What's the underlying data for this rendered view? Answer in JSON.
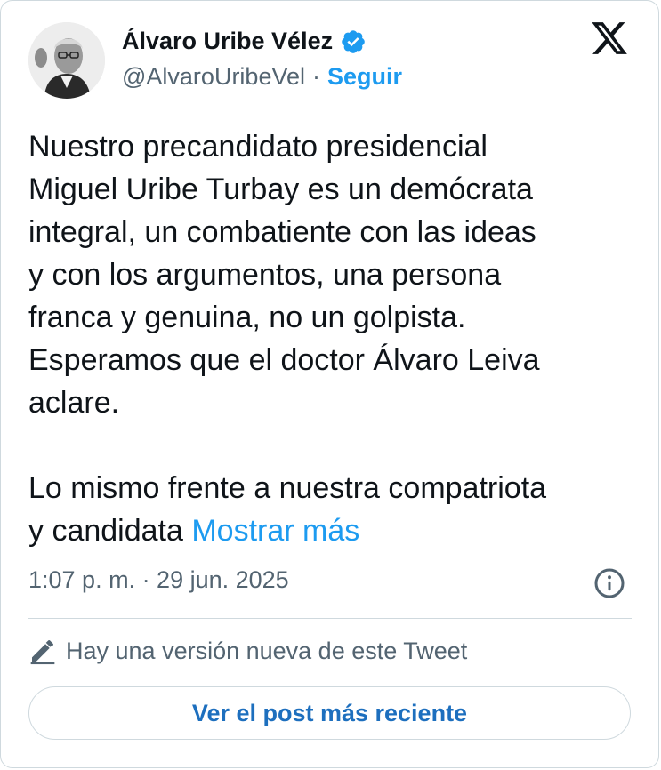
{
  "author": {
    "name": "Álvaro Uribe Vélez",
    "handle": "@AlvaroUribeVel",
    "separator": "·",
    "follow_label": "Seguir",
    "verified_icon": "verified-badge-icon",
    "avatar_alt": "avatar"
  },
  "platform": {
    "logo_icon": "x-logo-icon"
  },
  "tweet": {
    "body": "Nuestro precandidato presidencial\nMiguel Uribe Turbay es un demócrata\nintegral, un combatiente con las ideas\ny con los argumentos, una persona\nfranca y genuina, no un golpista.\nEsperamos que el doctor Álvaro Leiva\naclare.\n\nLo mismo frente a nuestra compatriota\ny candidata ",
    "show_more_label": "Mostrar más",
    "timestamp": "1:07 p. m. · 29 jun. 2025"
  },
  "edit_notice": {
    "text": "Hay una versión nueva de este Tweet",
    "icon": "pencil-icon"
  },
  "cta": {
    "label": "Ver el post más reciente"
  },
  "colors": {
    "accent": "#1d9bf0",
    "link_dark": "#1d6fbe",
    "text_primary": "#0f1419",
    "text_secondary": "#536471",
    "border": "#cfd9de"
  }
}
